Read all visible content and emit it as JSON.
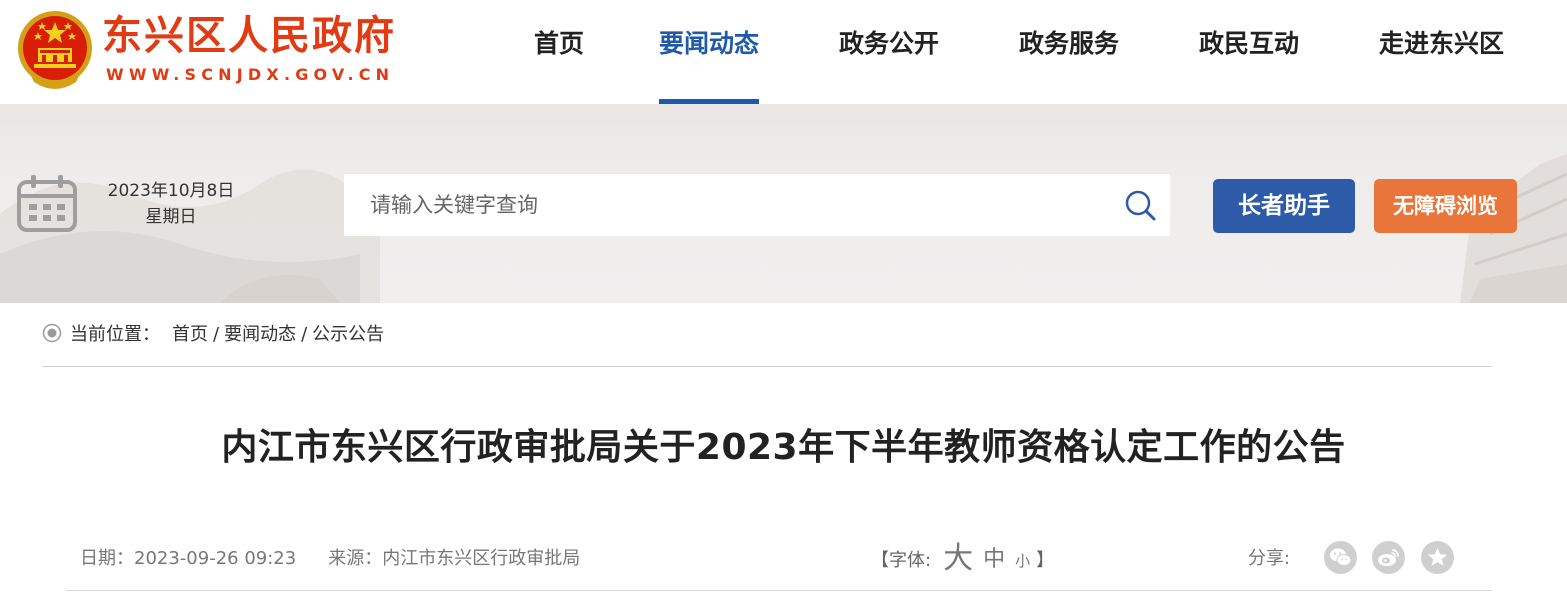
{
  "header": {
    "site_name": "东兴区人民政府",
    "site_url": "WWW.SCNJDX.GOV.CN",
    "nav": [
      {
        "label": "首页",
        "active": false
      },
      {
        "label": "要闻动态",
        "active": true
      },
      {
        "label": "政务公开",
        "active": false
      },
      {
        "label": "政务服务",
        "active": false
      },
      {
        "label": "政民互动",
        "active": false
      },
      {
        "label": "走进东兴区",
        "active": false
      }
    ]
  },
  "banner": {
    "date": "2023年10月8日",
    "weekday": "星期日",
    "search": {
      "placeholder": "请输入关键字查询",
      "value": "",
      "icon": "search-icon"
    },
    "elder_button": "长者助手",
    "accessibility_button": "无障碍浏览"
  },
  "breadcrumb": {
    "prefix": "当前位置：",
    "items": [
      "首页",
      "要闻动态",
      "公示公告"
    ],
    "separator": "/"
  },
  "article": {
    "title": "内江市东兴区行政审批局关于2023年下半年教师资格认定工作的公告",
    "date_label": "日期：",
    "date": "2023-09-26 09:23",
    "source_label": "来源：",
    "source": "内江市东兴区行政审批局",
    "font_open": "【字体:",
    "font_large": "大",
    "font_medium": "中",
    "font_small": "小",
    "font_close": "】",
    "share_label": "分享:",
    "share_icons": [
      "wechat-icon",
      "weibo-icon",
      "star-icon"
    ]
  },
  "colors": {
    "brand_red": "#e23b14",
    "nav_active": "#1e5aa8",
    "elder_button_bg": "#2e5ba8",
    "accessibility_button_bg": "#e9753a"
  }
}
